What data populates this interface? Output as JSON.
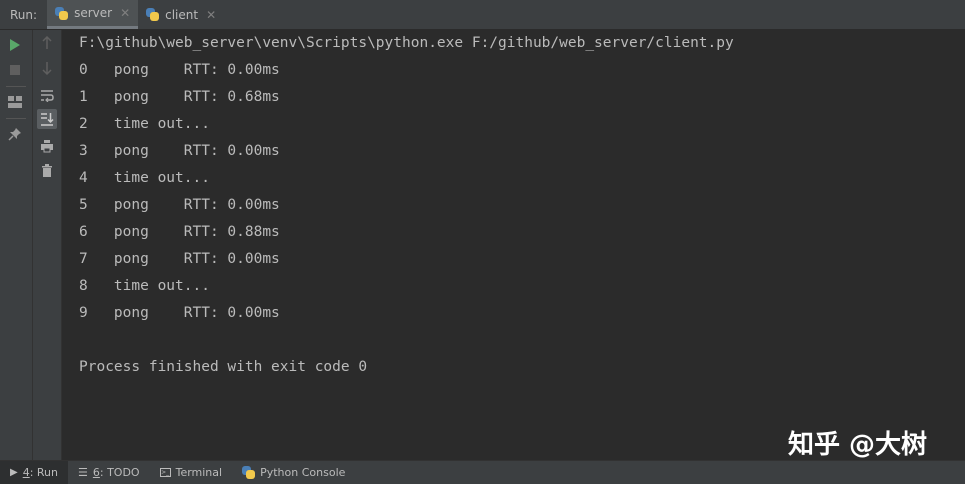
{
  "run_panel": {
    "label": "Run:",
    "tabs": [
      {
        "label": "server",
        "active": true
      },
      {
        "label": "client",
        "active": false
      }
    ]
  },
  "toolbar": {
    "icons": [
      "run-icon",
      "stop-icon",
      "layout-icon",
      "pin-icon",
      "up-arrow-icon",
      "down-arrow-icon",
      "soft-wrap-icon",
      "scroll-to-end-icon",
      "print-icon",
      "trash-icon"
    ]
  },
  "console": {
    "command": "F:\\github\\web_server\\venv\\Scripts\\python.exe F:/github/web_server/client.py",
    "lines": [
      "0   pong    RTT: 0.00ms",
      "1   pong    RTT: 0.68ms",
      "2   time out...",
      "3   pong    RTT: 0.00ms",
      "4   time out...",
      "5   pong    RTT: 0.00ms",
      "6   pong    RTT: 0.88ms",
      "7   pong    RTT: 0.00ms",
      "8   time out...",
      "9   pong    RTT: 0.00ms"
    ],
    "exit_message": "Process finished with exit code 0"
  },
  "watermark": "知乎 @大树",
  "statusbar": {
    "items": [
      {
        "num": "4",
        "label": ": Run",
        "active": true
      },
      {
        "num": "6",
        "label": ": TODO",
        "active": false
      },
      {
        "num": "",
        "label": "Terminal",
        "active": false
      },
      {
        "num": "",
        "label": "Python Console",
        "active": false
      }
    ]
  },
  "colors": {
    "background": "#2b2b2b",
    "panel": "#3c3f41",
    "text": "#bbbbbb",
    "run_green": "#59a869"
  }
}
